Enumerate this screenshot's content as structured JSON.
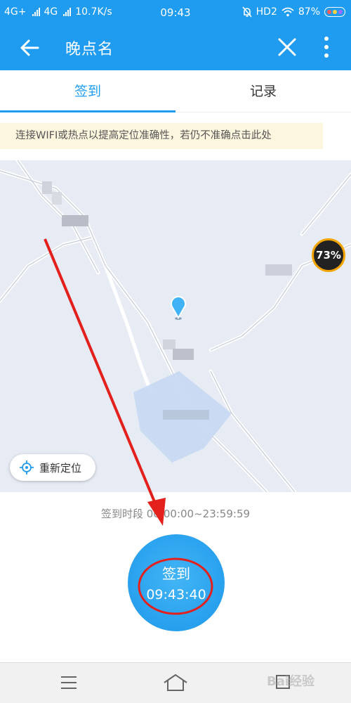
{
  "status_bar": {
    "network1": "4G+",
    "network2": "4G",
    "speed": "10.7K/s",
    "time": "09:43",
    "hd": "HD2",
    "battery": "87%"
  },
  "app_bar": {
    "title": "晚点名",
    "back_icon": "arrow-left-icon",
    "close_icon": "close-icon",
    "more_icon": "more-vertical-icon"
  },
  "tabs": [
    {
      "label": "签到",
      "active": true
    },
    {
      "label": "记录",
      "active": false
    }
  ],
  "notice": "连接WIFI或热点以提高定位准确性，若仍不准确点击此处",
  "map": {
    "relocate_label": "重新定位",
    "speed_badge": "73%"
  },
  "sign_period": "签到时段 00:00:00~23:59:59",
  "sign_button": {
    "label": "签到",
    "time": "09:43:40"
  },
  "watermark": "Bai经验",
  "colors": {
    "brand": "#1f9cf0",
    "notice_bg": "#fdf6de",
    "map_bg": "#e7ebf4",
    "annotation": "#e3201b"
  }
}
